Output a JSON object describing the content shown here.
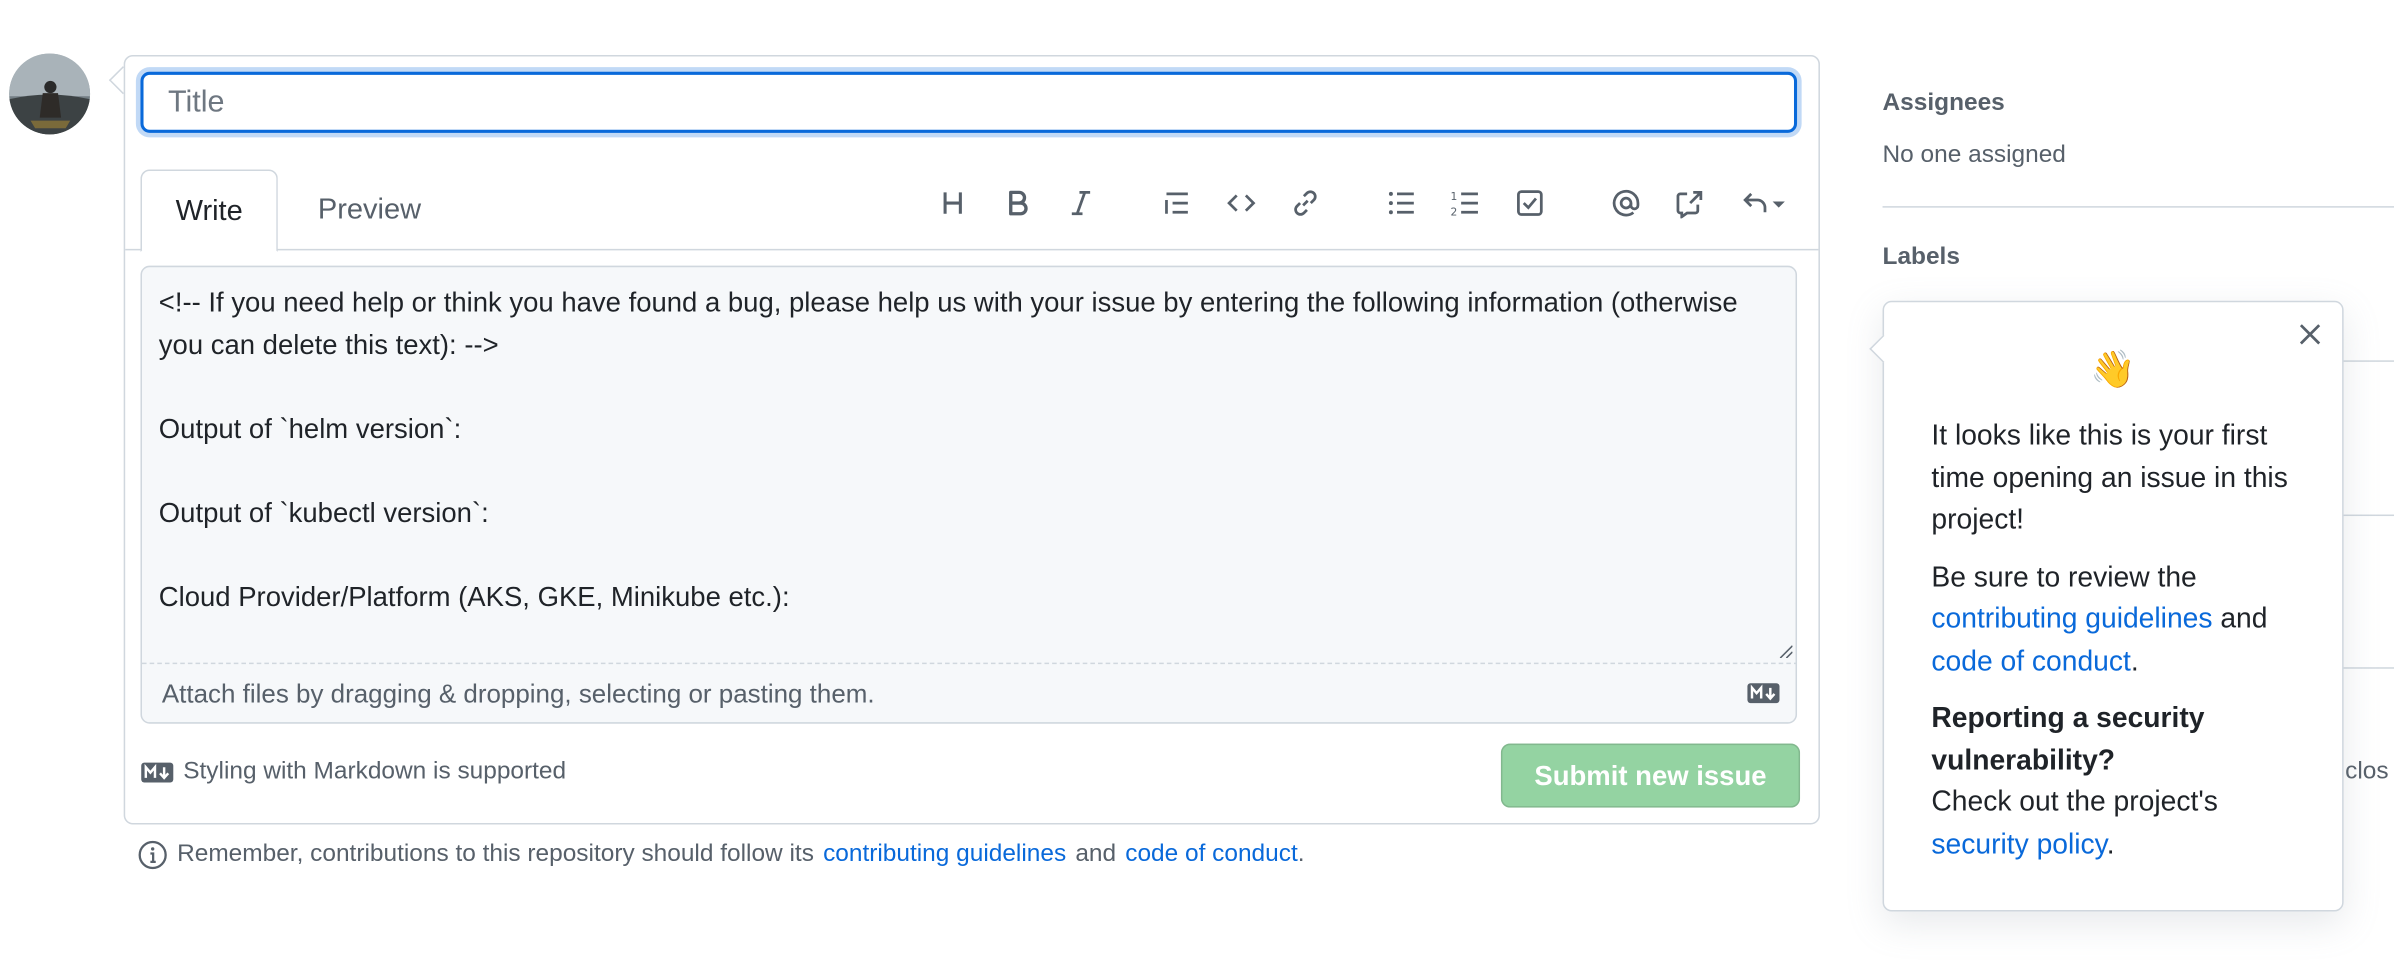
{
  "issue_form": {
    "title_placeholder": "Title",
    "tabs": {
      "write": "Write",
      "preview": "Preview"
    },
    "toolbar_icons": [
      "heading-icon",
      "bold-icon",
      "italic-icon",
      "quote-icon",
      "code-icon",
      "link-icon",
      "unordered-list-icon",
      "ordered-list-icon",
      "task-list-icon",
      "mention-icon",
      "cross-reference-icon",
      "saved-replies-icon"
    ],
    "body_text": "<!-- If you need help or think you have found a bug, please help us with your issue by entering the following information (otherwise you can delete this text): -->\n\nOutput of `helm version`:\n\nOutput of `kubectl version`:\n\nCloud Provider/Platform (AKS, GKE, Minikube etc.):",
    "attach_text": "Attach files by dragging & dropping, selecting or pasting them.",
    "markdown_note": "Styling with Markdown is supported",
    "submit_label": "Submit new issue",
    "submit_color": "#94d3a2"
  },
  "reminder": {
    "prefix": "Remember, contributions to this repository should follow its",
    "link1": "contributing guidelines",
    "and": "and",
    "link2": "code of conduct",
    "suffix": "."
  },
  "sidebar": {
    "assignees_heading": "Assignees",
    "assignees_value": "No one assigned",
    "labels_heading": "Labels",
    "partial_text": "clos"
  },
  "popover": {
    "emoji": "👋",
    "intro": "It looks like this is your first time opening an issue in this project!",
    "review_prefix": "Be sure to review the",
    "review_link1": "contributing guidelines",
    "review_and": "and",
    "review_link2": "code of conduct",
    "review_suffix": ".",
    "security_heading": "Reporting a security vulnerability?",
    "security_prefix": "Check out the project's",
    "security_link": "security policy",
    "security_suffix": "."
  },
  "colors": {
    "link": "#0969da",
    "border": "#d0d7de",
    "focus": "#0969da"
  }
}
